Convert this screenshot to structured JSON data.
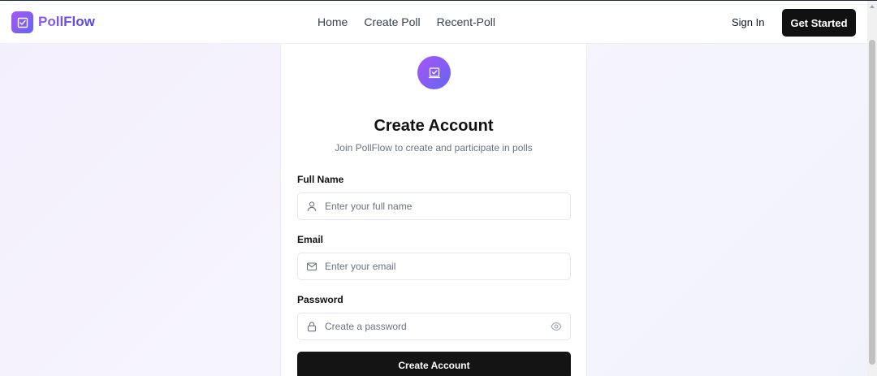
{
  "brand": {
    "name": "PollFlow",
    "logo_icon": "checkbox-chart-icon",
    "gradient_start": "#a855f7",
    "gradient_end": "#6366f1"
  },
  "nav": {
    "links": [
      "Home",
      "Create Poll",
      "Recent-Poll"
    ],
    "sign_in": "Sign In",
    "get_started": "Get Started"
  },
  "form": {
    "title": "Create Account",
    "subtitle": "Join PollFlow to create and participate in polls",
    "fields": [
      {
        "label": "Full Name",
        "placeholder": "Enter your full name",
        "value": "",
        "icon": "user-icon"
      },
      {
        "label": "Email",
        "placeholder": "Enter your email",
        "value": "",
        "icon": "mail-icon"
      },
      {
        "label": "Password",
        "placeholder": "Create a password",
        "value": "",
        "icon": "lock-icon",
        "toggle_icon": "eye-icon"
      }
    ],
    "submit_label": "Create Account",
    "submit_color": "#141414"
  }
}
